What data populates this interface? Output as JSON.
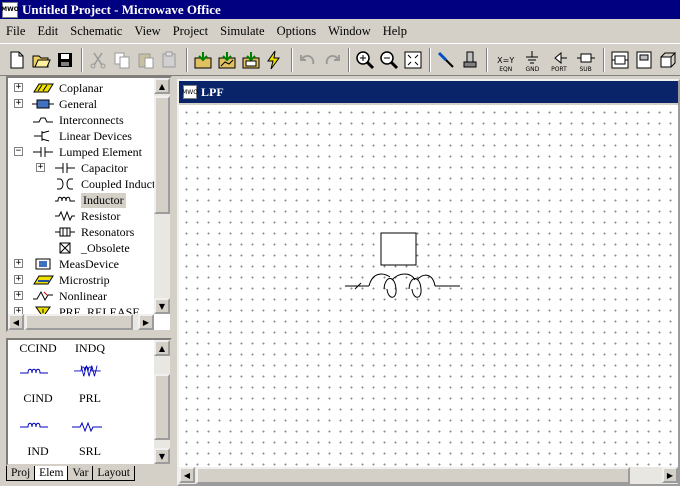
{
  "window": {
    "title": "Untitled Project - Microwave Office",
    "icon_text": "MWO"
  },
  "menu": [
    "File",
    "Edit",
    "Schematic",
    "View",
    "Project",
    "Simulate",
    "Options",
    "Window",
    "Help"
  ],
  "toolbar": {
    "eqn_label": "EQN",
    "gnd_label": "GND",
    "port_label": "PORT",
    "sub_label": "SUB",
    "eqn_symbol": "X=Y"
  },
  "tree": {
    "items": [
      {
        "label": "Coplanar",
        "expander": "+",
        "icon": "coplanar-icon"
      },
      {
        "label": "General",
        "expander": "+",
        "icon": "general-icon"
      },
      {
        "label": "Interconnects",
        "expander": "",
        "icon": "interconnect-icon"
      },
      {
        "label": "Linear Devices",
        "expander": "",
        "icon": "linear-device-icon"
      },
      {
        "label": "Lumped Element",
        "expander": "−",
        "icon": "capacitor-icon"
      },
      {
        "label": "Capacitor",
        "expander": "+",
        "icon": "capacitor-icon"
      },
      {
        "label": "Coupled Inductors",
        "expander": "",
        "icon": "coupled-inductor-icon"
      },
      {
        "label": "Inductor",
        "expander": "",
        "icon": "inductor-icon"
      },
      {
        "label": "Resistor",
        "expander": "",
        "icon": "resistor-icon"
      },
      {
        "label": "Resonators",
        "expander": "",
        "icon": "resonator-icon"
      },
      {
        "label": "_Obsolete",
        "expander": "",
        "icon": "obsolete-icon"
      },
      {
        "label": "MeasDevice",
        "expander": "+",
        "icon": "measdevice-icon"
      },
      {
        "label": "Microstrip",
        "expander": "+",
        "icon": "microstrip-icon"
      },
      {
        "label": "Nonlinear",
        "expander": "+",
        "icon": "nonlinear-icon"
      },
      {
        "label": "PRE_RELEASE",
        "expander": "+",
        "icon": "warning-icon"
      }
    ]
  },
  "elements": {
    "items": [
      "CCIND",
      "INDQ",
      "CIND",
      "PRL",
      "IND",
      "SRL"
    ]
  },
  "tabs": [
    "Proj",
    "Elem",
    "Var",
    "Layout"
  ],
  "document": {
    "title": "LPF",
    "icon_text": "MWO"
  }
}
